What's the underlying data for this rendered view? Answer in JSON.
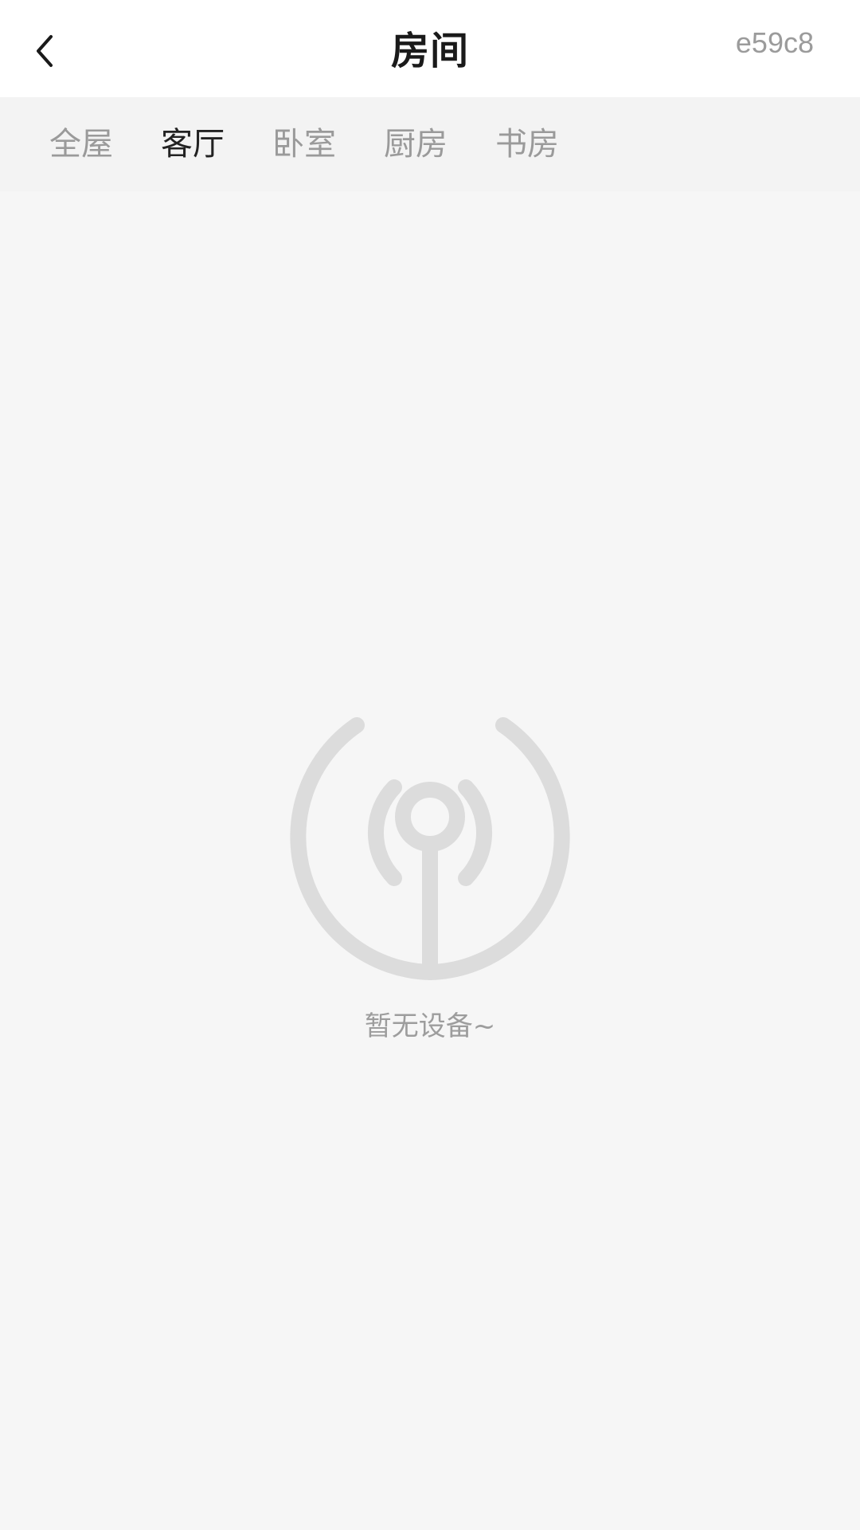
{
  "header": {
    "back_icon": "chevron-left-icon",
    "title": "房间",
    "code": "e59c8"
  },
  "room_tabs": {
    "items": [
      {
        "label": "全屋",
        "active": false
      },
      {
        "label": "客厅",
        "active": true
      },
      {
        "label": "卧室",
        "active": false
      },
      {
        "label": "厨房",
        "active": false
      },
      {
        "label": "书房",
        "active": false
      }
    ]
  },
  "empty_state": {
    "icon": "signal-broadcast-icon",
    "message": "暂无设备~"
  },
  "colors": {
    "background": "#f6f6f6",
    "header_background": "#ffffff",
    "tab_bar_background": "#f3f3f3",
    "active_tab_text": "#222222",
    "inactive_tab_text": "#9a9a9a",
    "icon_gray": "#dcdcdc"
  }
}
